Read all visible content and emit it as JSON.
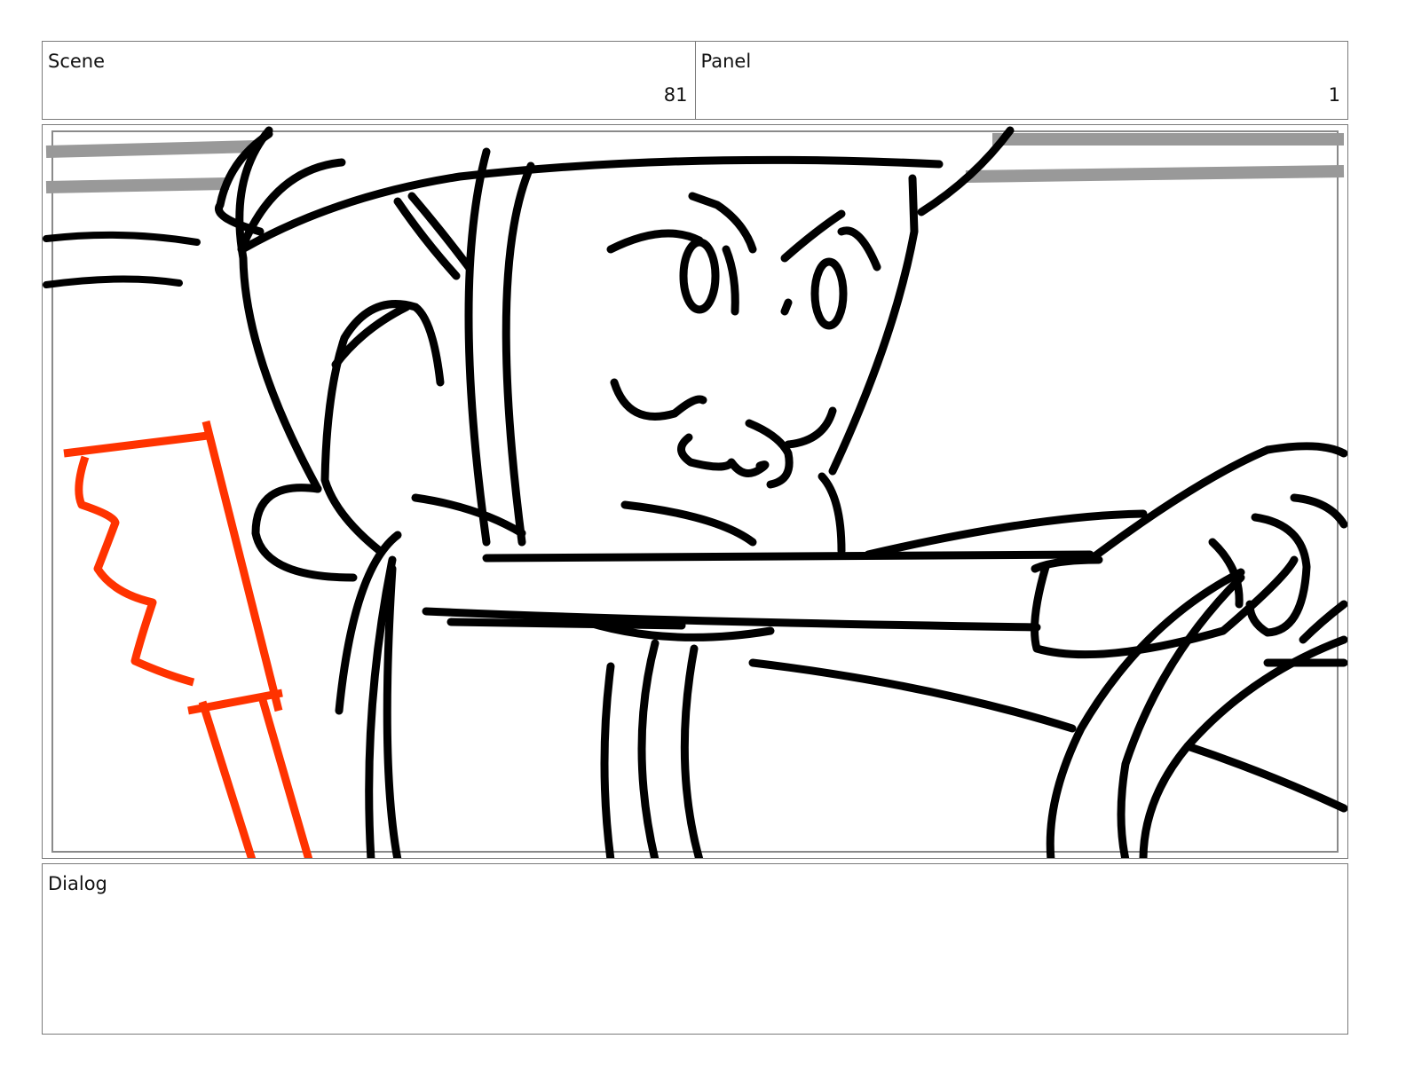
{
  "header": {
    "scene_label": "Scene",
    "scene_value": "81",
    "panel_label": "Panel",
    "panel_value": "1"
  },
  "drawing": {
    "line_color": "#000000",
    "accent_color": "#ff3300",
    "speedline_color": "#999999"
  },
  "dialog": {
    "label": "Dialog",
    "text": ""
  }
}
